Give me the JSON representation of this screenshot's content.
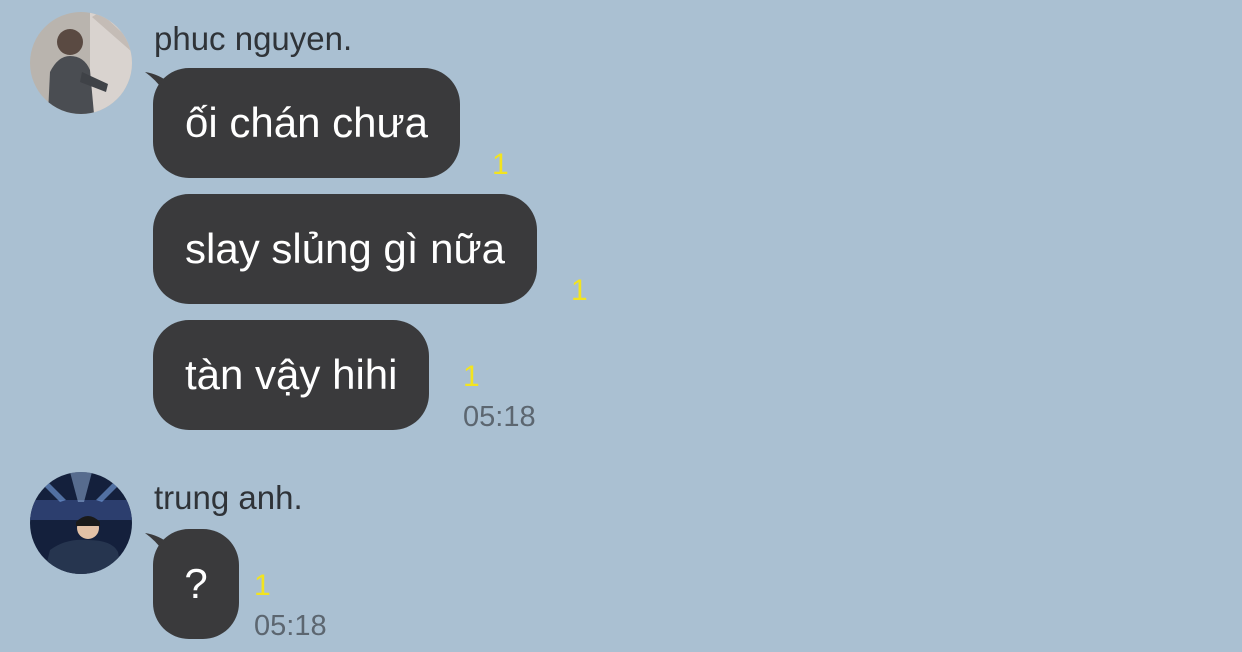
{
  "chat": {
    "groups": [
      {
        "sender": "phuc nguyen.",
        "messages": [
          {
            "text": "ối chán chưa",
            "unread": "1"
          },
          {
            "text": "slay slủng gì nữa",
            "unread": "1"
          },
          {
            "text": "tàn vậy hihi",
            "unread": "1",
            "time": "05:18"
          }
        ]
      },
      {
        "sender": "trung anh.",
        "messages": [
          {
            "text": "?",
            "unread": "1",
            "time": "05:18"
          }
        ]
      }
    ]
  },
  "colors": {
    "background": "#aac0d2",
    "bubble": "#3a3a3c",
    "unread": "#f3e41f"
  }
}
